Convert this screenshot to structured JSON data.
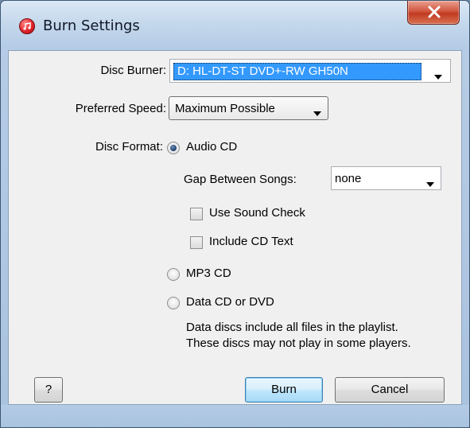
{
  "window": {
    "title": "Burn Settings",
    "icon": "itunes-disc-icon",
    "close_icon": "close-x-icon"
  },
  "disc_burner": {
    "label": "Disc Burner:",
    "value": "D: HL-DT-ST DVD+-RW GH50N"
  },
  "preferred_speed": {
    "label": "Preferred Speed:",
    "value": "Maximum Possible"
  },
  "disc_format": {
    "label": "Disc Format:",
    "options": [
      {
        "label": "Audio CD",
        "checked": true
      },
      {
        "label": "MP3 CD",
        "checked": false
      },
      {
        "label": "Data CD or DVD",
        "checked": false
      }
    ]
  },
  "audio_cd": {
    "gap_label": "Gap Between Songs:",
    "gap_value": "none",
    "use_sound_check": {
      "label": "Use Sound Check",
      "checked": false
    },
    "include_cd_text": {
      "label": "Include CD Text",
      "checked": false
    }
  },
  "data_note": {
    "line1": "Data discs include all files in the playlist.",
    "line2": "These discs may not play in some players."
  },
  "buttons": {
    "help": "?",
    "burn": "Burn",
    "cancel": "Cancel"
  },
  "colors": {
    "selection": "#3399ff",
    "default_button_border": "#3c7fb1",
    "close_button": "#c03a22"
  }
}
